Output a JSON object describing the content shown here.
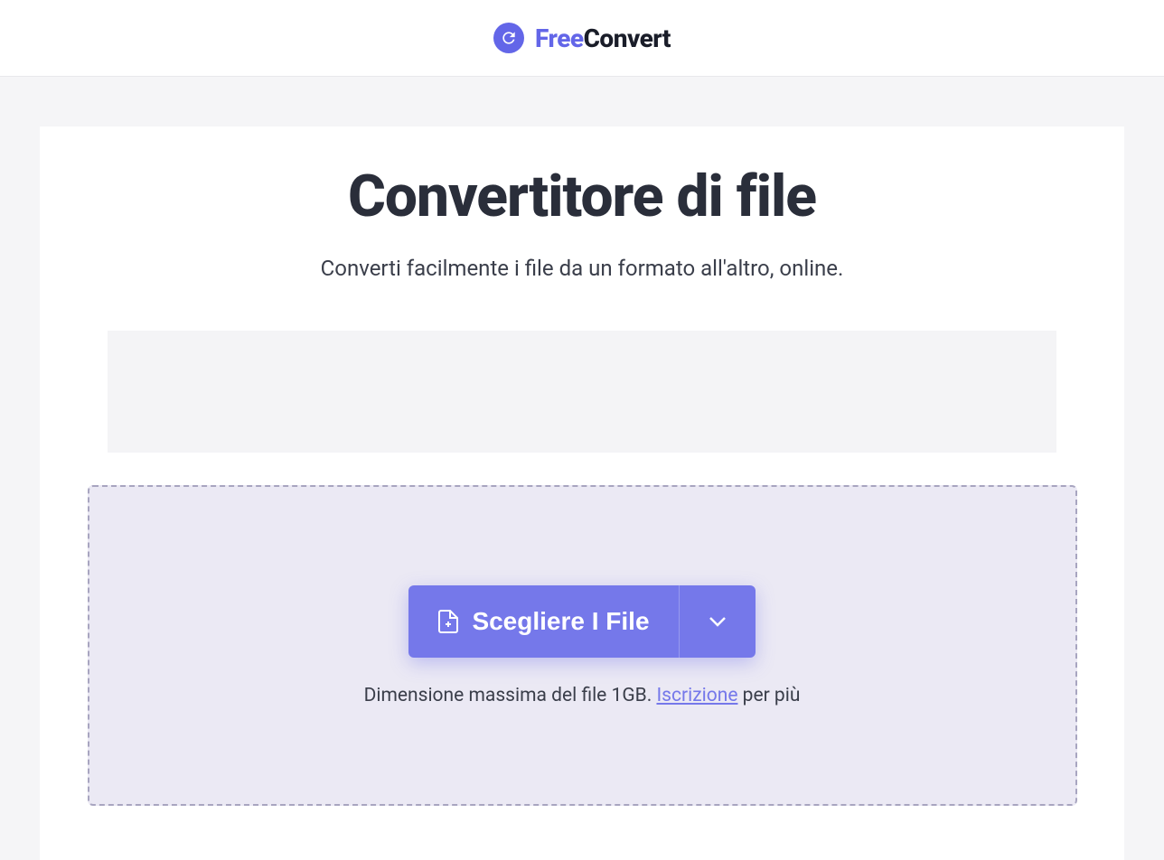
{
  "header": {
    "logo": {
      "free": "Free",
      "convert": "Convert"
    }
  },
  "main": {
    "title": "Convertitore di file",
    "subtitle": "Converti facilmente i file da un formato all'altro, online.",
    "chooseFilesLabel": "Scegliere I File",
    "fileSizeInfo": {
      "prefix": "Dimensione massima del file 1GB. ",
      "linkText": "Iscrizione",
      "suffix": " per più"
    }
  }
}
